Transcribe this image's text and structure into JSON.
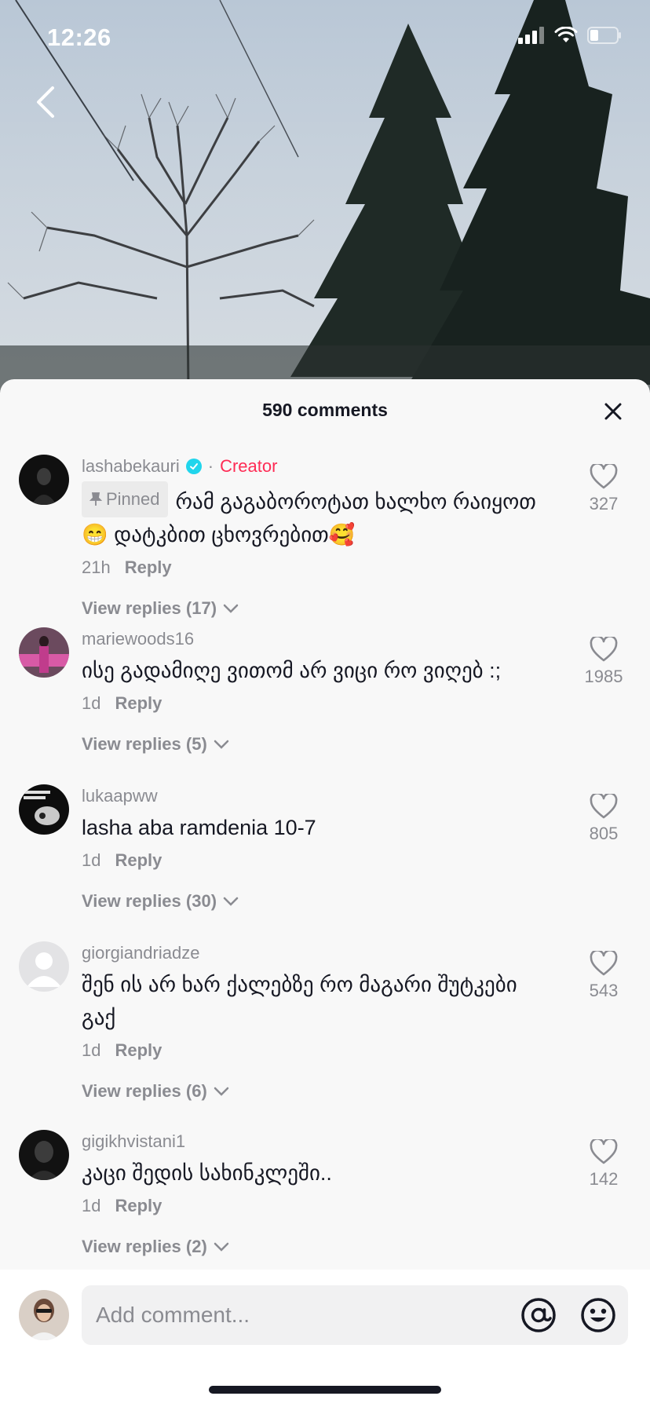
{
  "status_bar": {
    "time": "12:26"
  },
  "sheet": {
    "title": "590 comments"
  },
  "comments": [
    {
      "username": "lashabekauri",
      "creator_label": "Creator",
      "pinned_label": "Pinned",
      "text": "რამ გაგაბოროტათ ხალხო რაიყოთ😁 დატკბით ცხოვრებით🥰",
      "time": "21h",
      "reply_label": "Reply",
      "view_replies": "View replies (17)",
      "likes": "327"
    },
    {
      "username": "mariewoods16",
      "text": "ისე გადამიღე ვითომ არ ვიცი რო ვიღებ :;",
      "time": "1d",
      "reply_label": "Reply",
      "view_replies": "View replies (5)",
      "likes": "1985"
    },
    {
      "username": "lukaapww",
      "text": "lasha aba ramdenia 10-7",
      "time": "1d",
      "reply_label": "Reply",
      "view_replies": "View replies (30)",
      "likes": "805"
    },
    {
      "username": "giorgiandriadze",
      "text": "შენ ის არ ხარ ქალებზე რო მაგარი შუტკები გაქ",
      "time": "1d",
      "reply_label": "Reply",
      "view_replies": "View replies (6)",
      "likes": "543"
    },
    {
      "username": "gigikhvistani1",
      "text": "კაცი შედის სახინკლეში..",
      "time": "1d",
      "reply_label": "Reply",
      "view_replies": "View replies (2)",
      "likes": "142"
    }
  ],
  "input": {
    "placeholder": "Add comment..."
  },
  "colors": {
    "accent": "#fe2c55",
    "verified": "#20d5ec",
    "muted": "#8a8b91",
    "text": "#161823"
  }
}
